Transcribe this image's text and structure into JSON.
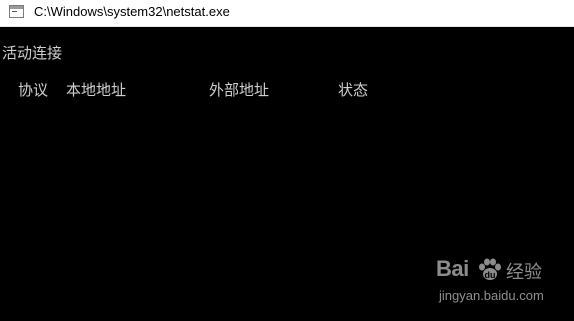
{
  "window": {
    "title": "C:\\Windows\\system32\\netstat.exe",
    "icon": "console-window-icon"
  },
  "console": {
    "section_title": "活动连接",
    "columns": [
      "协议",
      "本地地址",
      "外部地址",
      "状态"
    ]
  },
  "watermark": {
    "logo_text_left": "Bai",
    "logo_text_right": "经验",
    "url": "jingyan.baidu.com"
  }
}
